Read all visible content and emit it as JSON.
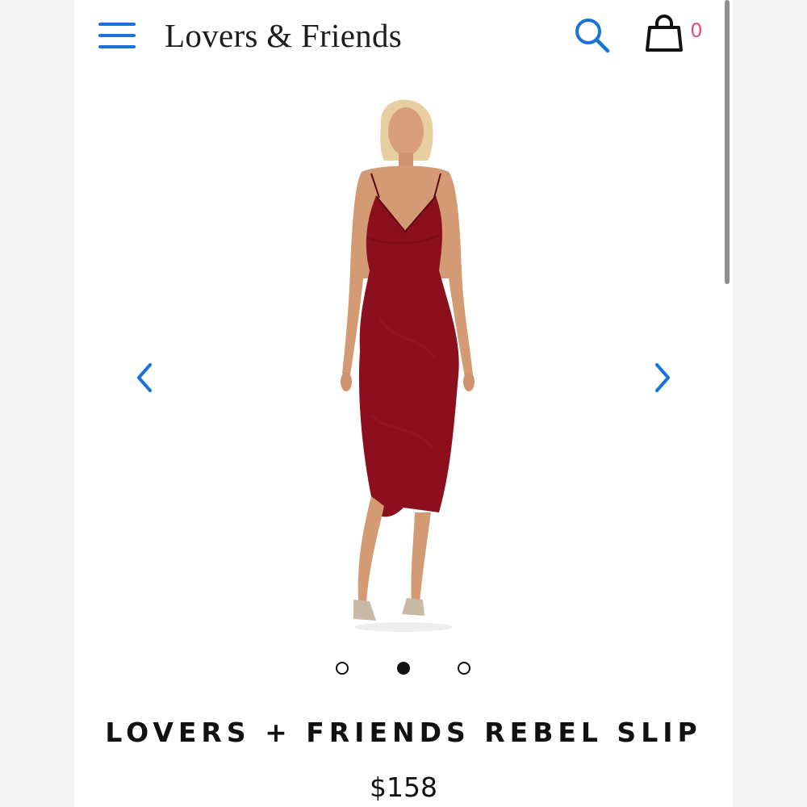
{
  "header": {
    "menu_icon": "hamburger-menu-icon",
    "logo_text": "Lovers & Friends",
    "search_icon": "search-icon",
    "bag_icon": "shopping-bag-icon",
    "bag_count": "0",
    "accent_color": "#1a73d9",
    "badge_color": "#e0457b"
  },
  "gallery": {
    "prev_icon": "chevron-left-icon",
    "next_icon": "chevron-right-icon",
    "dots": [
      "inactive",
      "active",
      "inactive"
    ],
    "dress_color": "#8b0f1d"
  },
  "product": {
    "title": "LOVERS + FRIENDS REBEL SLIP",
    "price": "$158"
  }
}
